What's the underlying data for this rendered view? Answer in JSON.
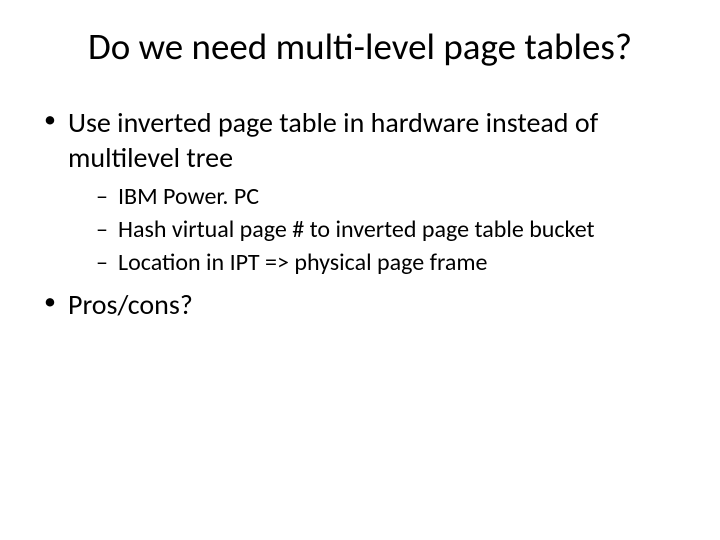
{
  "slide": {
    "title": "Do we need multi-level page tables?",
    "bullets": [
      {
        "text": "Use inverted page table in hardware instead of multilevel tree",
        "sub": [
          "IBM Power. PC",
          "Hash virtual page # to inverted page table bucket",
          "Location in IPT => physical page frame"
        ]
      },
      {
        "text": "Pros/cons?",
        "sub": []
      }
    ]
  }
}
